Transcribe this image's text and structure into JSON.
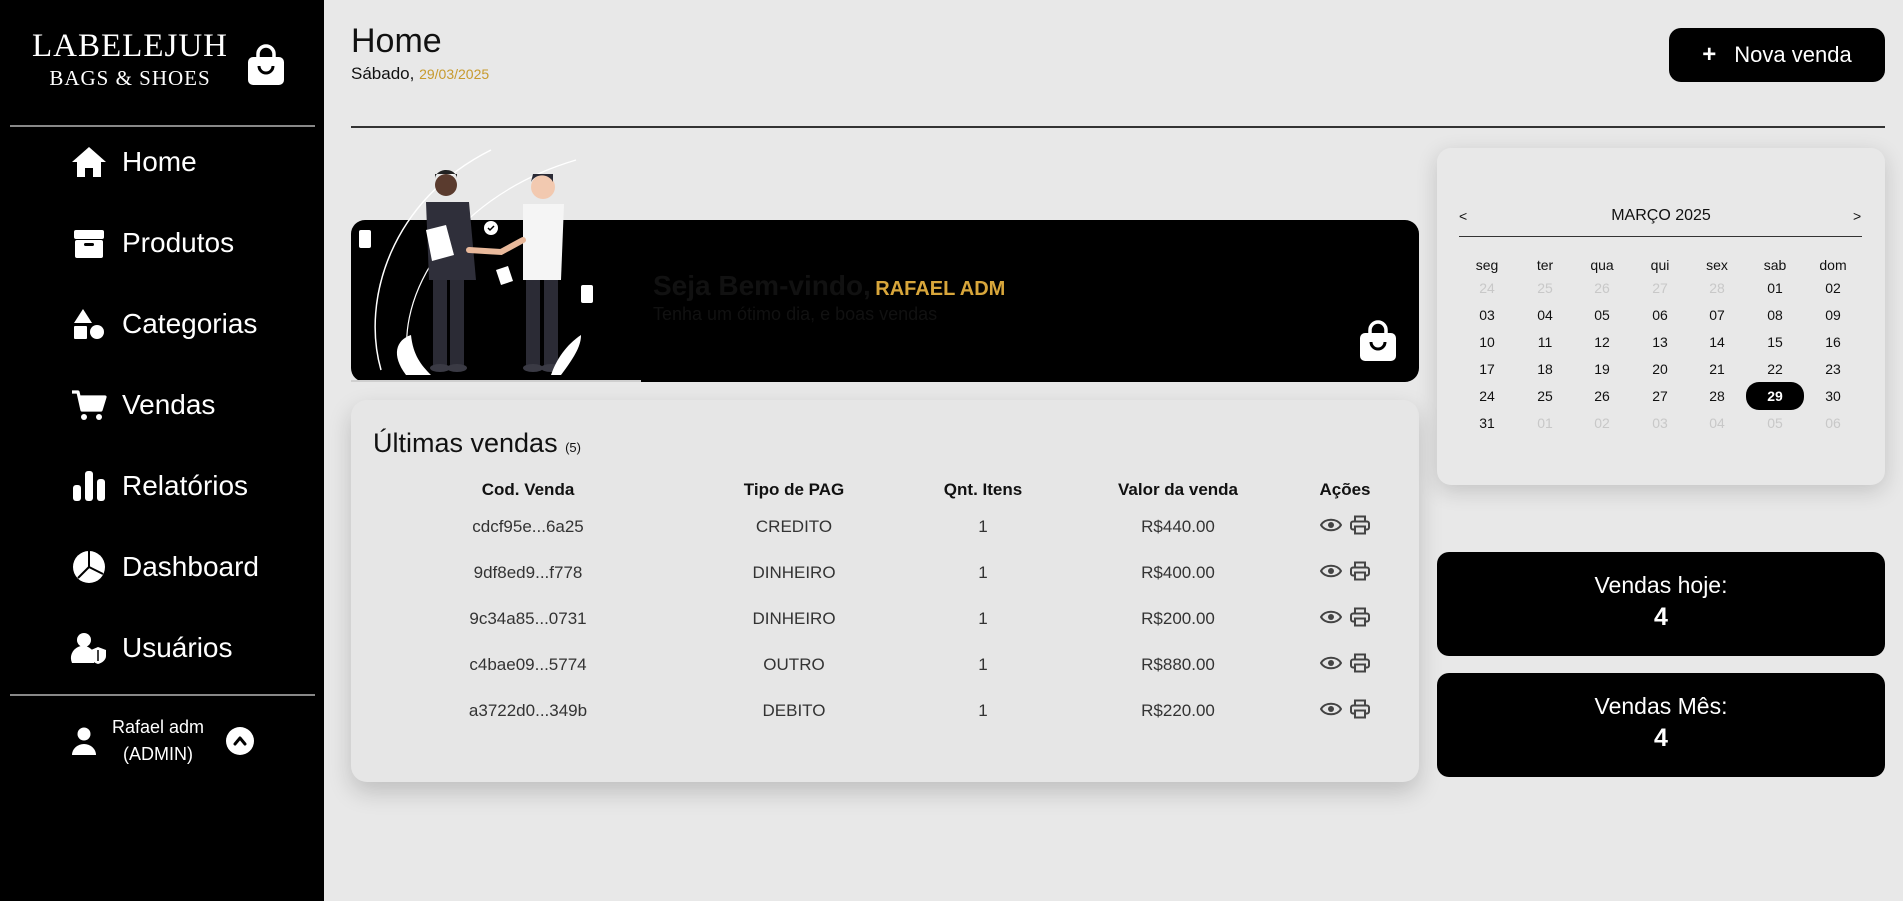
{
  "sidebar": {
    "logo_line1": "LABELEJUH",
    "logo_line2": "BAGS & SHOES",
    "items": [
      {
        "label": "Home",
        "icon": "home-icon"
      },
      {
        "label": "Produtos",
        "icon": "box-icon"
      },
      {
        "label": "Categorias",
        "icon": "shapes-icon"
      },
      {
        "label": "Vendas",
        "icon": "cart-icon"
      },
      {
        "label": "Relatórios",
        "icon": "bar-chart-icon"
      },
      {
        "label": "Dashboard",
        "icon": "pie-chart-icon"
      },
      {
        "label": "Usuários",
        "icon": "user-shield-icon"
      }
    ],
    "user_name": "Rafael adm",
    "user_role": "(ADMIN)"
  },
  "header": {
    "title": "Home",
    "weekday": "Sábado,",
    "date": "29/03/2025",
    "new_sale_label": "Nova venda"
  },
  "banner": {
    "greeting": "Seja Bem-vindo,",
    "name": "RAFAEL ADM",
    "subtitle": "Tenha um ótimo dia, e boas vendas"
  },
  "sales": {
    "title": "Últimas vendas",
    "count": "(5)",
    "columns": [
      "Cod. Venda",
      "Tipo de PAG",
      "Qnt. Itens",
      "Valor da venda",
      "Ações"
    ],
    "rows": [
      {
        "code": "cdcf95e...6a25",
        "payment": "CREDITO",
        "qty": "1",
        "value": "R$440.00"
      },
      {
        "code": "9df8ed9...f778",
        "payment": "DINHEIRO",
        "qty": "1",
        "value": "R$400.00"
      },
      {
        "code": "9c34a85...0731",
        "payment": "DINHEIRO",
        "qty": "1",
        "value": "R$200.00"
      },
      {
        "code": "c4bae09...5774",
        "payment": "OUTRO",
        "qty": "1",
        "value": "R$880.00"
      },
      {
        "code": "a3722d0...349b",
        "payment": "DEBITO",
        "qty": "1",
        "value": "R$220.00"
      }
    ]
  },
  "calendar": {
    "prev": "<",
    "next": ">",
    "month_label": "MARÇO 2025",
    "weekdays": [
      "seg",
      "ter",
      "qua",
      "qui",
      "sex",
      "sab",
      "dom"
    ],
    "weeks": [
      [
        "24",
        "25",
        "26",
        "27",
        "28",
        "01",
        "02"
      ],
      [
        "03",
        "04",
        "05",
        "06",
        "07",
        "08",
        "09"
      ],
      [
        "10",
        "11",
        "12",
        "13",
        "14",
        "15",
        "16"
      ],
      [
        "17",
        "18",
        "19",
        "20",
        "21",
        "22",
        "23"
      ],
      [
        "24",
        "25",
        "26",
        "27",
        "28",
        "29",
        "30"
      ],
      [
        "31",
        "01",
        "02",
        "03",
        "04",
        "05",
        "06"
      ]
    ],
    "selected": "29"
  },
  "stats": {
    "today_label": "Vendas hoje:",
    "today_value": "4",
    "month_label": "Vendas Mês:",
    "month_value": "4"
  },
  "colors": {
    "accent_gold": "#c79a2d",
    "sidebar_bg": "#000000",
    "page_bg": "#e8e8e8"
  }
}
